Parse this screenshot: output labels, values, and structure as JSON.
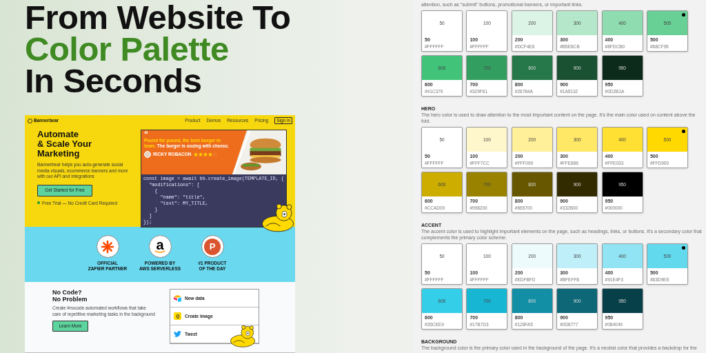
{
  "headline": {
    "lines": [
      {
        "text": "From Website To",
        "accent": false
      },
      {
        "text": "Color Palette",
        "accent": true
      },
      {
        "text": "In Seconds",
        "accent": false
      }
    ]
  },
  "website": {
    "nav": {
      "brand": "Bannerbear",
      "links": [
        "Product",
        "Demos",
        "Resources",
        "Pricing"
      ],
      "button": "Sign in"
    },
    "hero": {
      "title_lines": [
        "Automate",
        "& Scale Your",
        "Marketing"
      ],
      "text": "Bannerbear helps you auto-generate social media visuals, ecommerce banners and more with our API and integrations",
      "cta": "Get Started for Free",
      "note": "Free Trial — No Credit Card Required",
      "testimonial": {
        "quote_mark": "“",
        "quote": "Pound for pound, the best burger in town.",
        "quote_rest": "The burger is oozing with cheese.",
        "author": "RICKY ROBACON",
        "stars": 4
      },
      "code_lines": [
        "const image = await bb.create_image(TEMPLATE_ID, {",
        "  \"modifications\": [",
        "    {",
        "      \"name\": \"title\",",
        "      \"text\": MY_TITLE,",
        "    }",
        "  ]",
        "});"
      ]
    },
    "badges": [
      {
        "kind": "asterisk",
        "label_lines": [
          "OFFICIAL",
          "ZAPIER PARTNER"
        ]
      },
      {
        "kind": "letter-smile",
        "logo_text": "a",
        "label_lines": [
          "POWERED BY",
          "AWS SERVERLESS"
        ]
      },
      {
        "kind": "letter-circle",
        "logo_text": "P",
        "label_lines": [
          "#1 PRODUCT",
          "OF THE DAY"
        ]
      }
    ],
    "nocode": {
      "title_lines": [
        "No Code?",
        "No Problem"
      ],
      "text": "Create #nocode automated workflows that take care of repetitive marketing tasks in the background",
      "button": "Learn More",
      "steps": [
        {
          "kind": "blocks",
          "label": "New data"
        },
        {
          "kind": "bear",
          "label": "Create image"
        },
        {
          "kind": "bird",
          "label": "Tweet"
        }
      ]
    }
  },
  "palette": {
    "sections": [
      {
        "description": "attention, such as \"submit\" buttons, promotional banners, or important links.",
        "swatches": [
          {
            "label": "50",
            "name": "50",
            "hex": "#FFFFFF",
            "color": "#ffffff",
            "selected": false
          },
          {
            "label": "100",
            "name": "100",
            "hex": "#FFFFFF",
            "color": "#ffffff",
            "selected": false
          },
          {
            "label": "200",
            "name": "200",
            "hex": "#DCF4E6",
            "color": "#dcf4e6",
            "selected": false
          },
          {
            "label": "300",
            "name": "300",
            "hex": "#B5E8CB",
            "color": "#b5e8cb",
            "selected": false
          },
          {
            "label": "400",
            "name": "400",
            "hex": "#8FDCB0",
            "color": "#8fdcb0",
            "selected": false
          },
          {
            "label": "500",
            "name": "500",
            "hex": "#68CF95",
            "color": "#68cf95",
            "selected": true
          },
          {
            "label": "600",
            "name": "600",
            "hex": "#41C379",
            "color": "#41c379",
            "selected": false
          },
          {
            "label": "700",
            "name": "700",
            "hex": "#329F61",
            "color": "#329f61",
            "selected": false
          },
          {
            "label": "800",
            "name": "800",
            "hex": "#26784A",
            "color": "#26784a",
            "selected": false
          },
          {
            "label": "900",
            "name": "900",
            "hex": "#1A5132",
            "color": "#1a5132",
            "selected": false
          },
          {
            "label": "950",
            "name": "950",
            "hex": "#0D2B1A",
            "color": "#0d2b1a",
            "selected": false
          }
        ]
      },
      {
        "title": "HERO",
        "description": "The hero color is used to draw attention to the most important content on the page. It's the main color used on content above the fold.",
        "swatches": [
          {
            "label": "50",
            "name": "50",
            "hex": "#FFFFFF",
            "color": "#ffffff",
            "selected": false
          },
          {
            "label": "100",
            "name": "100",
            "hex": "#FFF7CC",
            "color": "#fff7cc",
            "selected": false
          },
          {
            "label": "200",
            "name": "200",
            "hex": "#FFF099",
            "color": "#fff099",
            "selected": false
          },
          {
            "label": "300",
            "name": "300",
            "hex": "#FFE866",
            "color": "#ffe866",
            "selected": false
          },
          {
            "label": "400",
            "name": "400",
            "hex": "#FFE033",
            "color": "#ffe033",
            "selected": false
          },
          {
            "label": "500",
            "name": "500",
            "hex": "#FFD900",
            "color": "#ffd900",
            "selected": true
          },
          {
            "label": "600",
            "name": "600",
            "hex": "#CCAD00",
            "color": "#ccad00",
            "selected": false
          },
          {
            "label": "700",
            "name": "700",
            "hex": "#998200",
            "color": "#998200",
            "selected": false
          },
          {
            "label": "800",
            "name": "800",
            "hex": "#665700",
            "color": "#665700",
            "selected": false
          },
          {
            "label": "900",
            "name": "900",
            "hex": "#332B00",
            "color": "#332b00",
            "selected": false
          },
          {
            "label": "950",
            "name": "950",
            "hex": "#000000",
            "color": "#000000",
            "selected": false
          }
        ]
      },
      {
        "title": "ACCENT",
        "description": "The accent color is used to highlight important elements on the page, such as headings, links, or buttons. It's a secondary color that complements the primary color scheme.",
        "swatches": [
          {
            "label": "50",
            "name": "50",
            "hex": "#FFFFFF",
            "color": "#ffffff",
            "selected": false
          },
          {
            "label": "100",
            "name": "100",
            "hex": "#FFFFFF",
            "color": "#ffffff",
            "selected": false
          },
          {
            "label": "200",
            "name": "200",
            "hex": "#EDFBFD",
            "color": "#edfbfd",
            "selected": false
          },
          {
            "label": "300",
            "name": "300",
            "hex": "#BFEFF8",
            "color": "#bfeff8",
            "selected": false
          },
          {
            "label": "400",
            "name": "400",
            "hex": "#91E4F3",
            "color": "#91e4f3",
            "selected": false
          },
          {
            "label": "500",
            "name": "500",
            "hex": "#63D9EE",
            "color": "#63d9ee",
            "selected": true
          },
          {
            "label": "600",
            "name": "600",
            "hex": "#35CEE9",
            "color": "#35cee9",
            "selected": false
          },
          {
            "label": "700",
            "name": "700",
            "hex": "#17B7D3",
            "color": "#17b7d3",
            "selected": false
          },
          {
            "label": "800",
            "name": "800",
            "hex": "#128FA5",
            "color": "#128fa5",
            "selected": false
          },
          {
            "label": "900",
            "name": "900",
            "hex": "#0D6777",
            "color": "#0d6777",
            "selected": false
          },
          {
            "label": "950",
            "name": "950",
            "hex": "#084049",
            "color": "#084049",
            "selected": false
          }
        ]
      },
      {
        "title": "BACKGROUND",
        "description": "The background color is the primary color used in the background of the page. It's a neutral color that provides a backdrop for the"
      }
    ]
  }
}
